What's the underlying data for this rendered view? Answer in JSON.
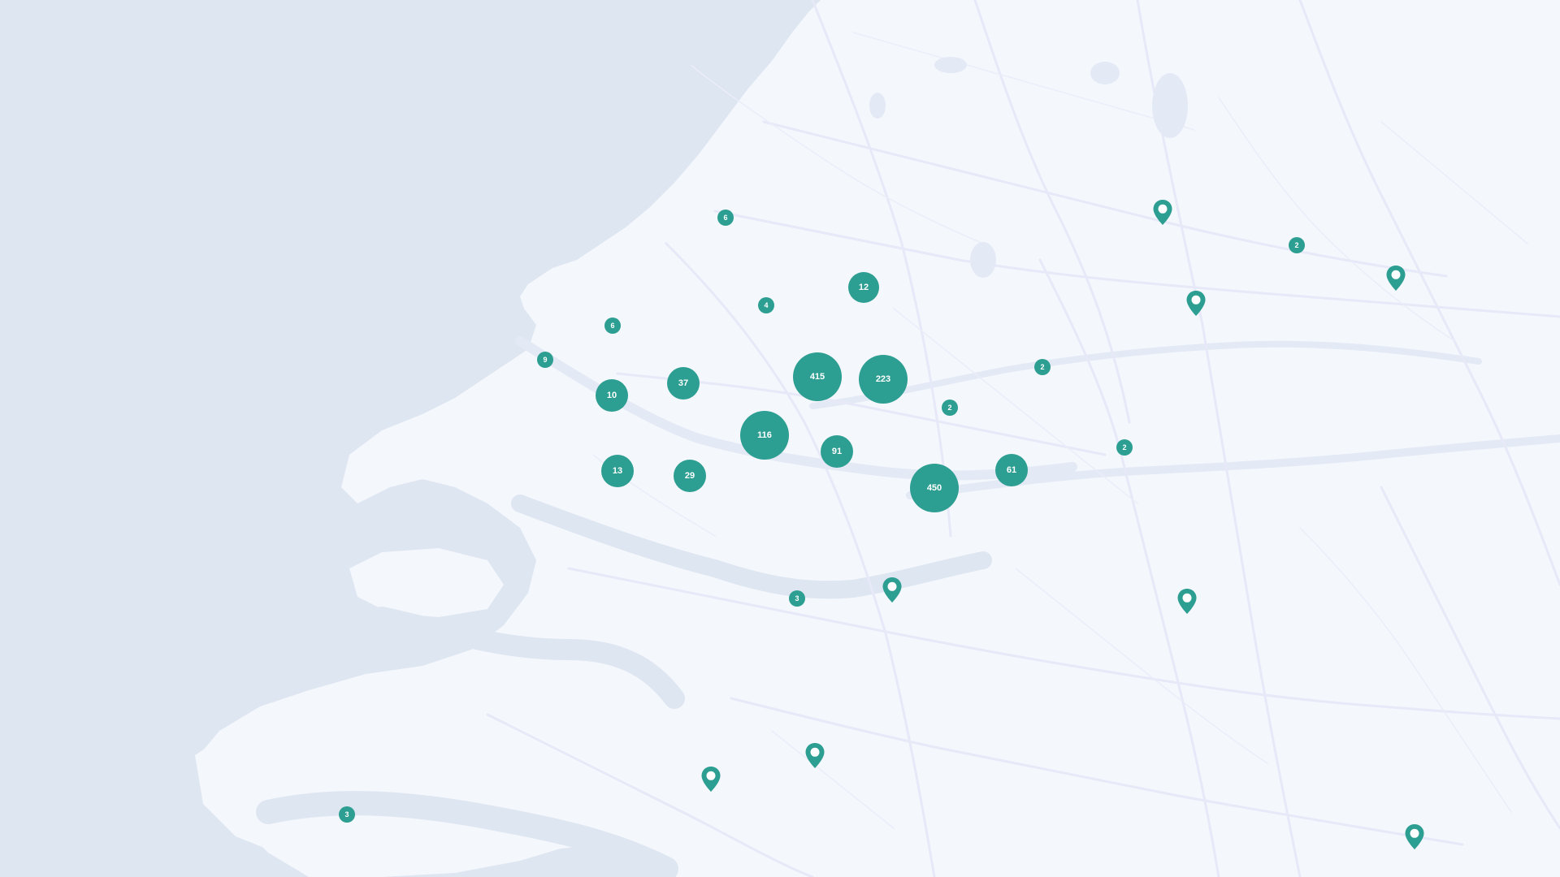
{
  "map": {
    "colors": {
      "sea": "#dee6f1",
      "land": "#f4f7fc",
      "water_inland": "#e3e9f5",
      "roads": "#e7e9f8",
      "marker": "#2d9e92",
      "marker_text": "#ffffff"
    },
    "clusters": [
      {
        "count": "6"
      },
      {
        "count": "4"
      },
      {
        "count": "12"
      },
      {
        "count": "6"
      },
      {
        "count": "9"
      },
      {
        "count": "10"
      },
      {
        "count": "37"
      },
      {
        "count": "415"
      },
      {
        "count": "223"
      },
      {
        "count": "2"
      },
      {
        "count": "116"
      },
      {
        "count": "91"
      },
      {
        "count": "13"
      },
      {
        "count": "29"
      },
      {
        "count": "450"
      },
      {
        "count": "61"
      },
      {
        "count": "2"
      },
      {
        "count": "2"
      },
      {
        "count": "2"
      },
      {
        "count": "3"
      },
      {
        "count": "3"
      }
    ],
    "pins": [
      {
        "icon": "map-pin-icon"
      },
      {
        "icon": "map-pin-icon"
      },
      {
        "icon": "map-pin-icon"
      },
      {
        "icon": "map-pin-icon"
      },
      {
        "icon": "map-pin-icon"
      },
      {
        "icon": "map-pin-icon"
      },
      {
        "icon": "map-pin-icon"
      },
      {
        "icon": "map-pin-icon"
      }
    ]
  }
}
